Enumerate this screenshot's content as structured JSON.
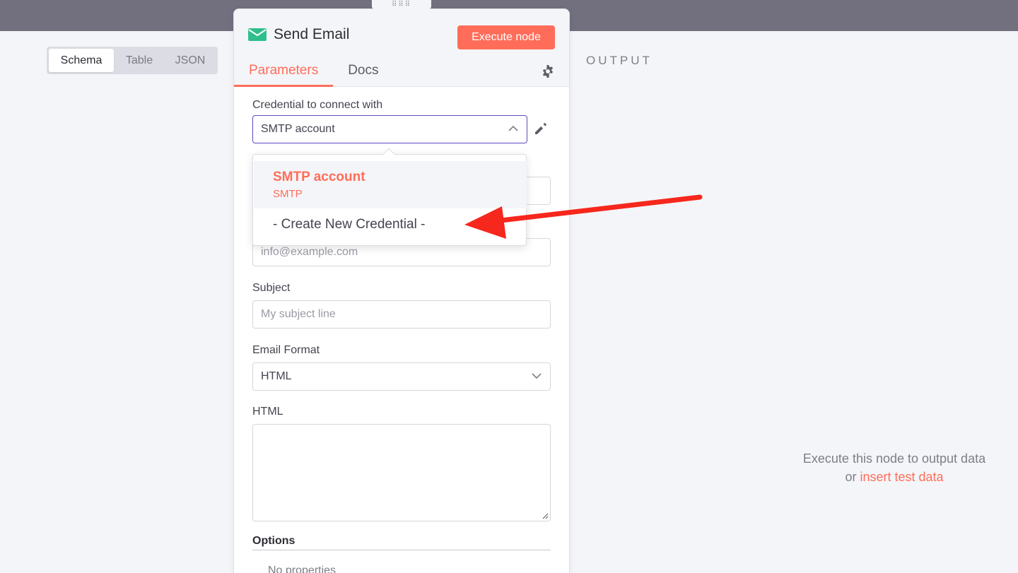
{
  "view_toggle": {
    "options": [
      "Schema",
      "Table",
      "JSON"
    ],
    "active": "Schema"
  },
  "node": {
    "title": "Send Email",
    "execute_label": "Execute node",
    "tabs": [
      "Parameters",
      "Docs"
    ],
    "active_tab": "Parameters"
  },
  "fields": {
    "credential": {
      "label": "Credential to connect with",
      "value": "SMTP account"
    },
    "to_email": {
      "placeholder": "info@example.com"
    },
    "subject": {
      "label": "Subject",
      "placeholder": "My subject line"
    },
    "email_format": {
      "label": "Email Format",
      "value": "HTML"
    },
    "html": {
      "label": "HTML"
    },
    "options": {
      "label": "Options",
      "empty_text": "No properties"
    }
  },
  "credential_dropdown": {
    "selected": {
      "name": "SMTP account",
      "type": "SMTP"
    },
    "create_label": "- Create New Credential -"
  },
  "output": {
    "label": "OUTPUT",
    "empty_line1": "Execute this node to output data",
    "empty_or": "or",
    "empty_link": "insert test data"
  },
  "colors": {
    "accent": "#ff6d5a",
    "focus": "#5b4bc4",
    "header_band": "#72707f",
    "mail_icon": "#2fbf8c",
    "arrow": "#f6271c"
  }
}
